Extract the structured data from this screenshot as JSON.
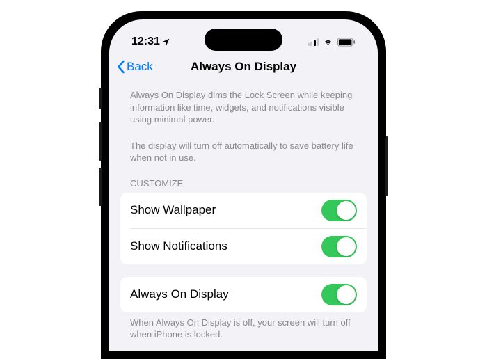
{
  "status": {
    "time": "12:31",
    "location_icon": "➤"
  },
  "nav": {
    "back_label": "Back",
    "title": "Always On Display"
  },
  "description1": "Always On Display dims the Lock Screen while keeping information like time, widgets, and notifications visible using minimal power.",
  "description2": "The display will turn off automatically to save battery life when not in use.",
  "customize": {
    "header": "CUSTOMIZE",
    "rows": [
      {
        "label": "Show Wallpaper",
        "on": true
      },
      {
        "label": "Show Notifications",
        "on": true
      }
    ]
  },
  "aod": {
    "label": "Always On Display",
    "on": true,
    "footer": "When Always On Display is off, your screen will turn off when iPhone is locked."
  }
}
